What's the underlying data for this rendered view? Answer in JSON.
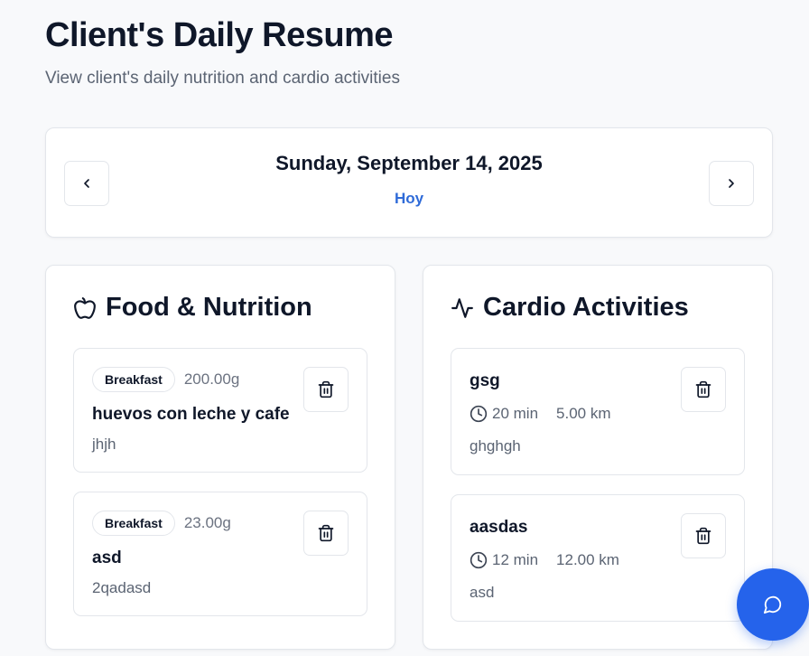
{
  "header": {
    "title": "Client's Daily Resume",
    "subtitle": "View client's daily nutrition and cardio activities"
  },
  "date_nav": {
    "date": "Sunday, September 14, 2025",
    "today_label": "Hoy",
    "prev_icon": "chevron-left-icon",
    "next_icon": "chevron-right-icon"
  },
  "food": {
    "title": "Food & Nutrition",
    "icon": "apple-icon",
    "items": [
      {
        "meal": "Breakfast",
        "weight": "200.00g",
        "name": "huevos con leche y cafe",
        "note": "jhjh"
      },
      {
        "meal": "Breakfast",
        "weight": "23.00g",
        "name": "asd",
        "note": "2qadasd"
      }
    ]
  },
  "cardio": {
    "title": "Cardio Activities",
    "icon": "activity-icon",
    "items": [
      {
        "name": "gsg",
        "duration": "20 min",
        "distance": "5.00 km",
        "note": "ghghgh"
      },
      {
        "name": "aasdas",
        "duration": "12 min",
        "distance": "12.00 km",
        "note": "asd"
      }
    ]
  },
  "chat_fab": {
    "icon": "chat-icon"
  },
  "colors": {
    "accent": "#2563eb",
    "link": "#2f6bd8",
    "border": "#e3e6eb",
    "background": "#f8f9fb"
  }
}
